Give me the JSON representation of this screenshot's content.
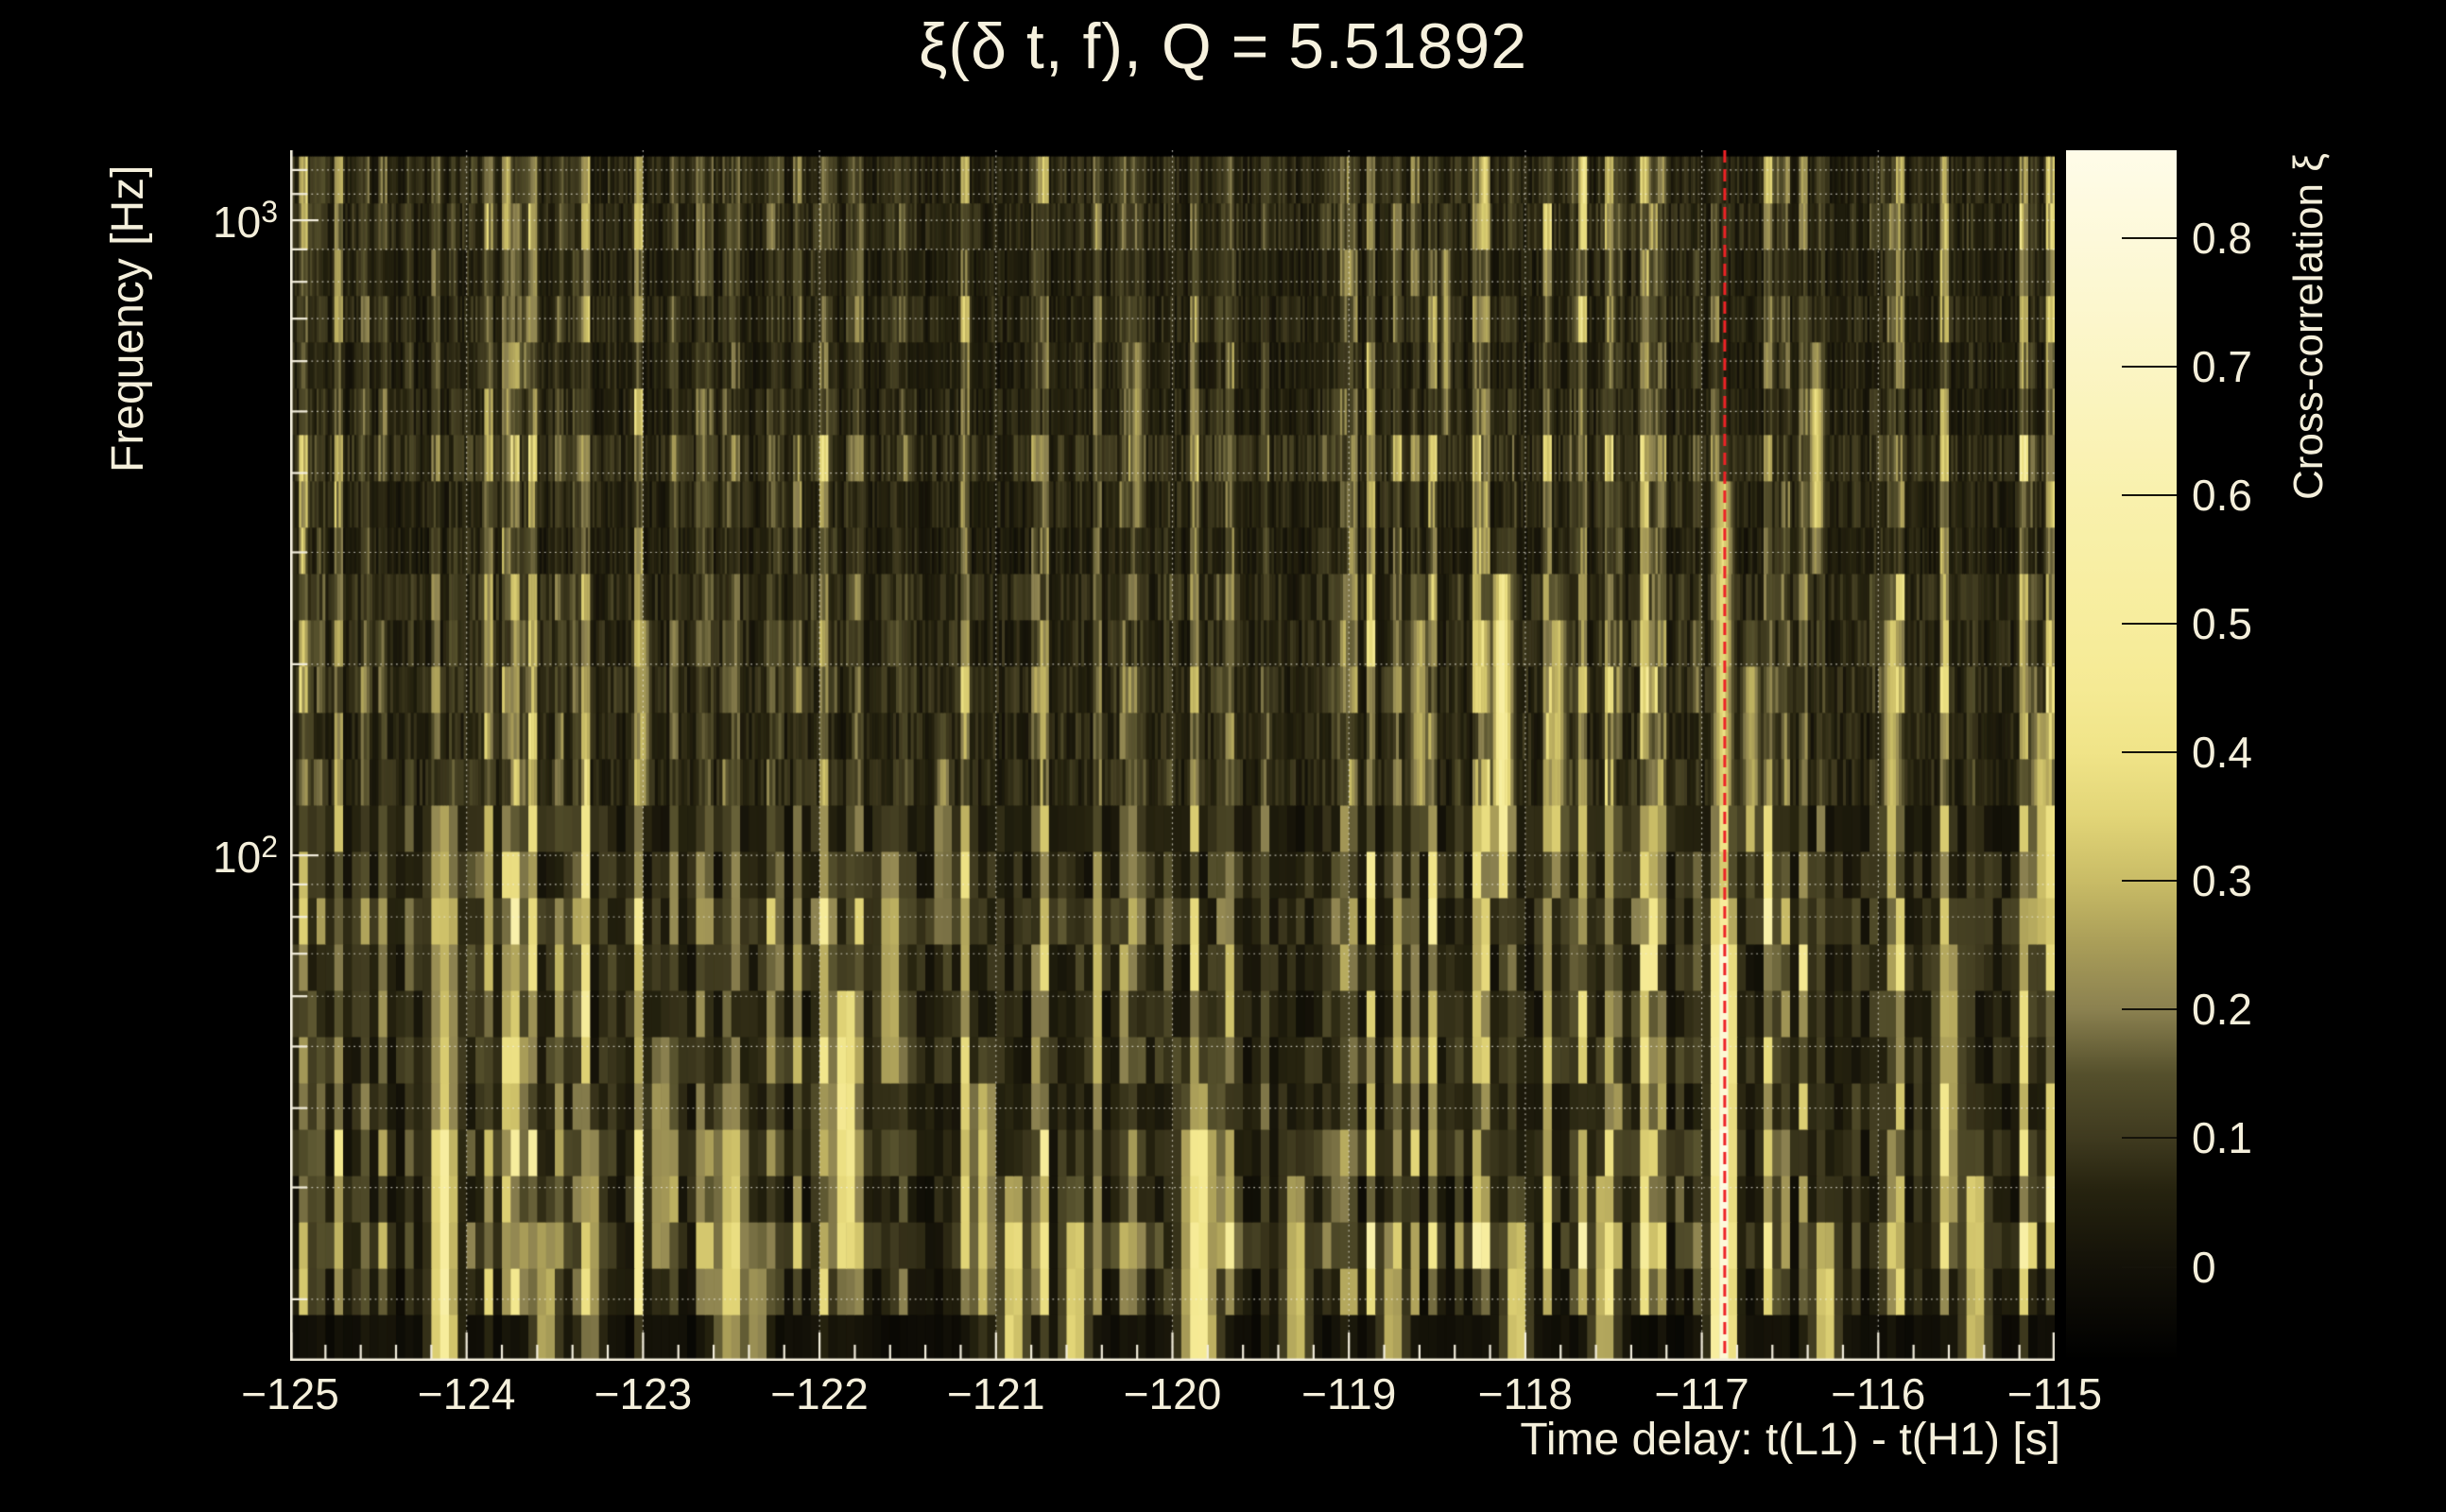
{
  "title": "ξ(δ t, f), Q = 5.51892",
  "axes": {
    "x": {
      "title": "Time delay: t(L1) - t(H1) [s]",
      "min": -125,
      "max": -115,
      "tick_values": [
        -125,
        -124,
        -123,
        -122,
        -121,
        -120,
        -119,
        -118,
        -117,
        -116,
        -115
      ],
      "tick_labels": [
        "−125",
        "−124",
        "−123",
        "−122",
        "−121",
        "−120",
        "−119",
        "−118",
        "−117",
        "−116",
        "−115"
      ],
      "minor_tick_step": 0.2
    },
    "y": {
      "title": "Frequency [Hz]",
      "scale": "log",
      "min": 16,
      "max": 1289,
      "major_ticks": [
        {
          "base": "10",
          "exp": "2",
          "value": 100
        },
        {
          "base": "10",
          "exp": "3",
          "value": 1000
        }
      ],
      "grid_values": [
        20,
        30,
        40,
        50,
        60,
        70,
        80,
        90,
        100,
        200,
        300,
        400,
        500,
        600,
        700,
        800,
        900,
        1000,
        1100,
        1200
      ]
    },
    "z": {
      "title": "Cross-correlation ξ",
      "min": -0.073,
      "max": 0.868,
      "tick_values": [
        0,
        0.1,
        0.2,
        0.3,
        0.4,
        0.5,
        0.6,
        0.7,
        0.8
      ],
      "tick_labels": [
        "0",
        "0.1",
        "0.2",
        "0.3",
        "0.4",
        "0.5",
        "0.6",
        "0.7",
        "0.8"
      ]
    }
  },
  "marker_line": {
    "x": -116.87,
    "color": "#ee2226",
    "style": "dashed"
  },
  "colors": {
    "background": "#000000",
    "text": "#f4efdb",
    "axis": "#f2eddc",
    "grid": "rgba(242,240,228,0.72)"
  },
  "chart_data": {
    "type": "heatmap",
    "title": "ξ(δ t, f), Q = 5.51892",
    "xlabel": "Time delay: t(L1) - t(H1) [s]",
    "ylabel": "Frequency [Hz]",
    "zlabel": "Cross-correlation ξ",
    "x_range": [
      -125,
      -115
    ],
    "y_range_hz": [
      16,
      1289
    ],
    "y_scale": "log",
    "z_range": [
      -0.073,
      0.868
    ],
    "time_bin_s": 0.05,
    "q_value": 5.51892,
    "marker_line_x": -116.87,
    "peak": {
      "time_delay_s": -116.88,
      "freq_band_hz": [
        16,
        64
      ],
      "xi": 0.86
    },
    "noise": {
      "median_xi": 0.08,
      "typical_streak_xi": 0.3
    },
    "hotspots": [
      [
        -124.13,
        16,
        30,
        0.58,
        0.05
      ],
      [
        -124.13,
        30,
        95,
        0.34,
        0.06
      ],
      [
        -123.55,
        16,
        21,
        0.32,
        0.05
      ],
      [
        -123.3,
        21,
        30,
        0.3,
        0.05
      ],
      [
        -123.0,
        150,
        190,
        0.3,
        0.03
      ],
      [
        -122.9,
        28,
        40,
        0.3,
        0.05
      ],
      [
        -122.5,
        21,
        32,
        0.38,
        0.07
      ],
      [
        -122.35,
        16,
        20,
        0.3,
        0.04
      ],
      [
        -121.85,
        27,
        48,
        0.48,
        0.06
      ],
      [
        -121.6,
        55,
        80,
        0.32,
        0.05
      ],
      [
        -121.3,
        90,
        120,
        0.3,
        0.03
      ],
      [
        -121.07,
        24,
        36,
        0.34,
        0.05
      ],
      [
        -120.9,
        16,
        24,
        0.42,
        0.05
      ],
      [
        -120.55,
        16,
        22,
        0.4,
        0.05
      ],
      [
        -120.2,
        420,
        520,
        0.28,
        0.025
      ],
      [
        -119.85,
        16,
        32,
        0.5,
        0.07
      ],
      [
        -119.3,
        16,
        24,
        0.36,
        0.05
      ],
      [
        -118.75,
        16,
        20,
        0.33,
        0.05
      ],
      [
        -118.6,
        140,
        200,
        0.3,
        0.04
      ],
      [
        -118.45,
        600,
        760,
        0.3,
        0.02
      ],
      [
        -118.13,
        115,
        215,
        0.56,
        0.04
      ],
      [
        -118.05,
        16,
        22,
        0.38,
        0.05
      ],
      [
        -117.82,
        115,
        200,
        0.34,
        0.04
      ],
      [
        -117.55,
        16,
        25,
        0.35,
        0.05
      ],
      [
        -116.88,
        16,
        64,
        0.86,
        0.045
      ],
      [
        -116.88,
        64,
        310,
        0.4,
        0.04
      ],
      [
        -116.72,
        120,
        170,
        0.3,
        0.04
      ],
      [
        -116.35,
        380,
        480,
        0.4,
        0.03
      ],
      [
        -116.3,
        16,
        21,
        0.4,
        0.05
      ],
      [
        -115.92,
        125,
        200,
        0.34,
        0.04
      ],
      [
        -115.6,
        30,
        60,
        0.3,
        0.06
      ],
      [
        -115.45,
        16,
        26,
        0.38,
        0.05
      ],
      [
        -115.08,
        90,
        130,
        0.35,
        0.04
      ]
    ],
    "colormap": [
      [
        -0.073,
        "#000000"
      ],
      [
        0.0,
        "#131108"
      ],
      [
        0.06,
        "#26230f"
      ],
      [
        0.1,
        "#3f3a1f"
      ],
      [
        0.15,
        "#55502c"
      ],
      [
        0.2,
        "#8b8150"
      ],
      [
        0.25,
        "#a99d58"
      ],
      [
        0.3,
        "#c9bc66"
      ],
      [
        0.35,
        "#e2d577"
      ],
      [
        0.4,
        "#f0e488"
      ],
      [
        0.45,
        "#f5ea94"
      ],
      [
        0.5,
        "#f7ed9d"
      ],
      [
        0.55,
        "#f8efa5"
      ],
      [
        0.6,
        "#f9f1ad"
      ],
      [
        0.7,
        "#fbf5c4"
      ],
      [
        0.8,
        "#fdf9da"
      ],
      [
        0.868,
        "#fffce9"
      ]
    ]
  }
}
